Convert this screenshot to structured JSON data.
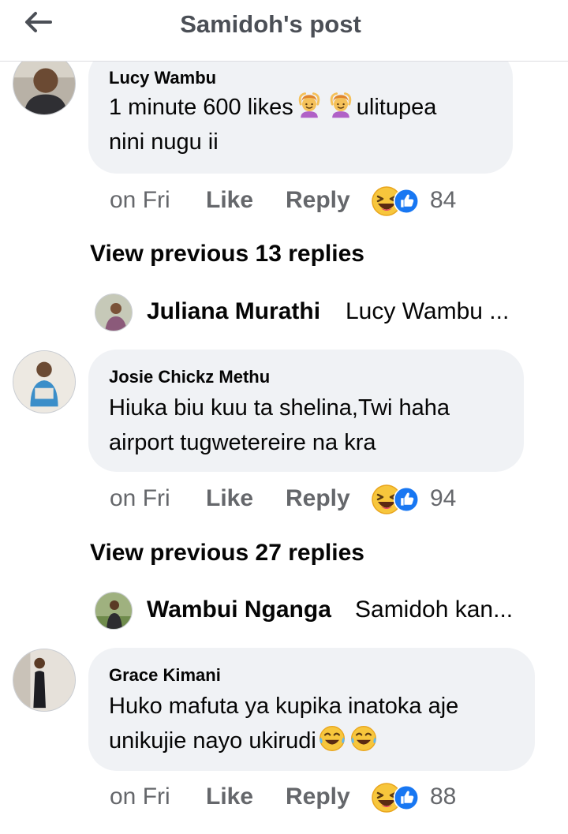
{
  "header": {
    "title": "Samidoh's post",
    "back_icon": "arrow-left-icon"
  },
  "comments": [
    {
      "author": "Lucy Wambu",
      "line1": "1 minute 600 likes",
      "line1_after": "ulitupea",
      "line2": "nini nugu ii",
      "inline_emojis": [
        "person-gesturing-ok-icon",
        "person-gesturing-ok-icon"
      ],
      "time": "on Fri",
      "like_label": "Like",
      "reply_label": "Reply",
      "reactions": [
        "haha-icon",
        "like-icon"
      ],
      "reaction_count": "84"
    },
    {
      "author": "Josie Chickz Methu",
      "line1": "Hiuka biu kuu ta shelina,Twi haha",
      "line2": "airport tugwetereire na kra",
      "time": "on Fri",
      "like_label": "Like",
      "reply_label": "Reply",
      "reactions": [
        "haha-icon",
        "like-icon"
      ],
      "reaction_count": "94"
    },
    {
      "author": "Grace Kimani",
      "line1": "Huko mafuta ya kupika inatoka aje",
      "line2": "unikujie nayo ukirudi",
      "inline_emojis": [
        "tears-of-joy-icon",
        "tears-of-joy-icon"
      ],
      "time": "on Fri",
      "like_label": "Like",
      "reply_label": "Reply",
      "reactions": [
        "haha-icon",
        "like-icon"
      ],
      "reaction_count": "88"
    }
  ],
  "replies": [
    {
      "view_previous": "View previous 13 replies",
      "name": "Juliana Murathi",
      "snippet": "Lucy Wambu ..."
    },
    {
      "view_previous": "View previous 27 replies",
      "name": "Wambui Nganga",
      "snippet": "Samidoh kan..."
    }
  ],
  "colors": {
    "bubble": "#f0f2f5",
    "meta": "#65676b",
    "text": "#050505",
    "like_blue": "#1877f2",
    "haha_yellow": "#f7b928"
  }
}
